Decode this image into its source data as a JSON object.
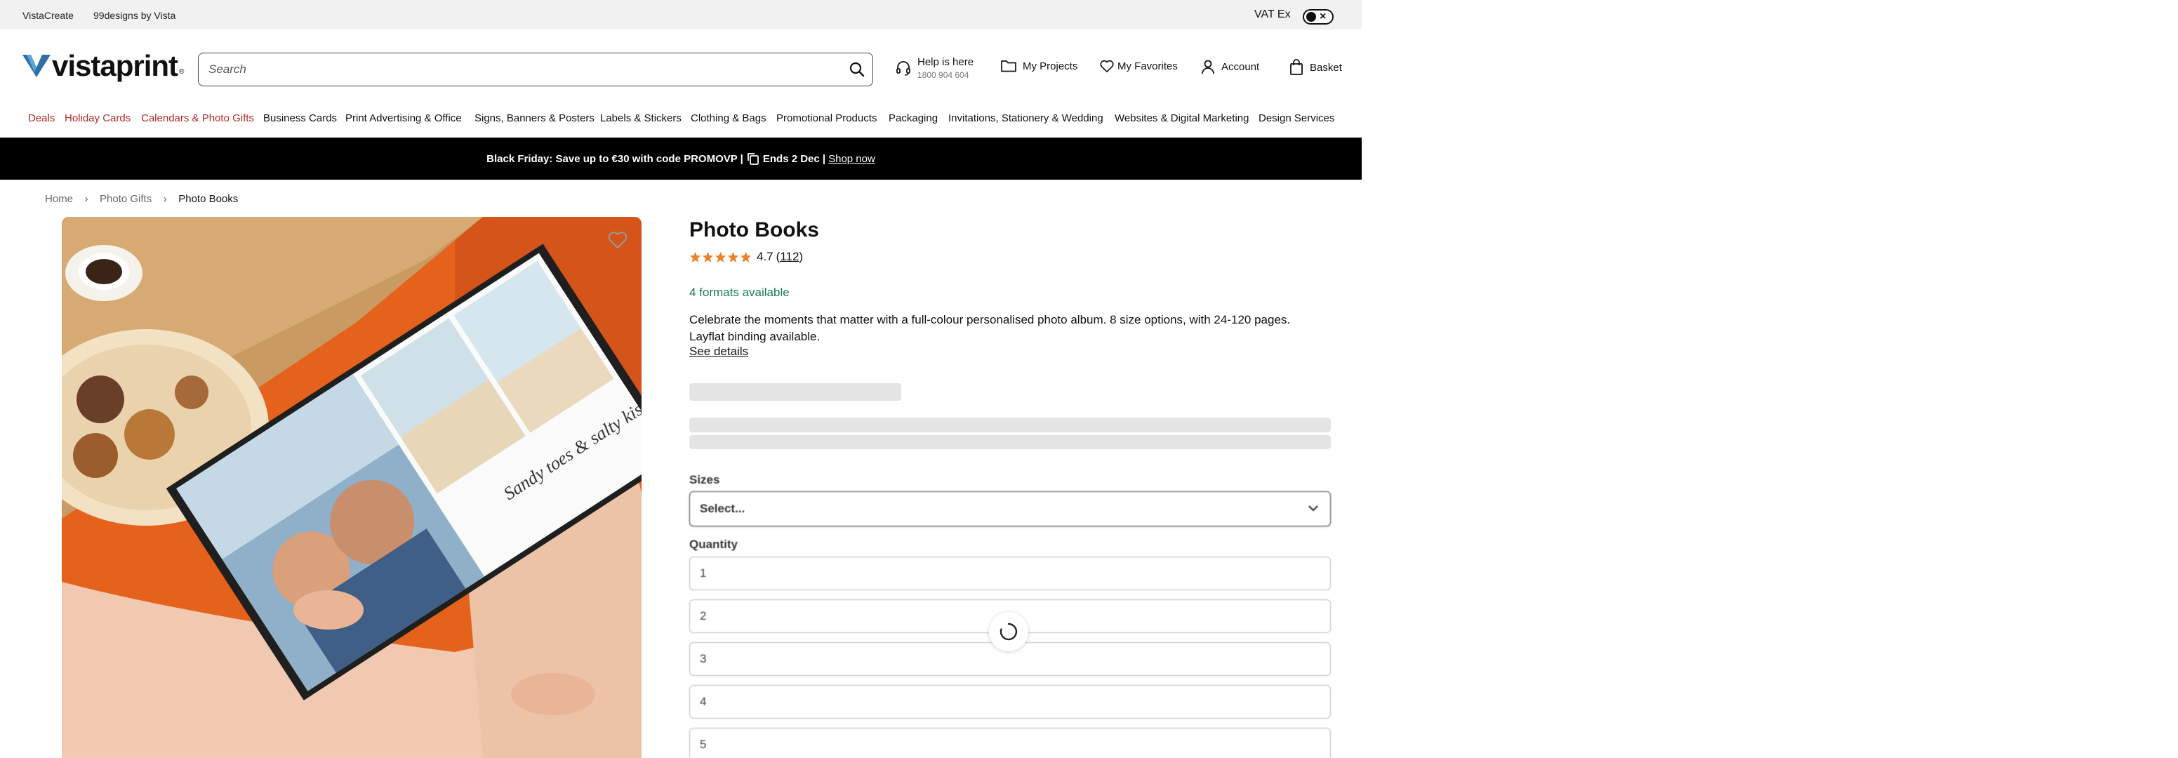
{
  "utility_bar": {
    "links": [
      "VistaCreate",
      "99designs by Vista"
    ],
    "vat_label": "VAT Ex",
    "vat_toggle_state": "off"
  },
  "header": {
    "logo_text": "vistaprint",
    "logo_tm": "®",
    "search_placeholder": "Search",
    "search_value": "",
    "help_title": "Help is here",
    "help_phone": "1800 904 604",
    "my_projects": "My Projects",
    "my_favorites": "My Favorites",
    "account": "Account",
    "basket": "Basket",
    "icons": [
      "search-icon",
      "headset-icon",
      "folder-icon",
      "heart-icon",
      "user-icon",
      "shopping-bag-icon"
    ]
  },
  "nav": {
    "items": [
      {
        "label": "Deals",
        "highlight": true
      },
      {
        "label": "Holiday Cards",
        "highlight": true
      },
      {
        "label": "Calendars & Photo Gifts",
        "highlight": true
      },
      {
        "label": "Business Cards",
        "highlight": false
      },
      {
        "label": "Print Advertising & Office",
        "highlight": false
      },
      {
        "label": "Signs, Banners & Posters",
        "highlight": false
      },
      {
        "label": "Labels & Stickers",
        "highlight": false
      },
      {
        "label": "Clothing & Bags",
        "highlight": false
      },
      {
        "label": "Promotional Products",
        "highlight": false
      },
      {
        "label": "Packaging",
        "highlight": false
      },
      {
        "label": "Invitations, Stationery & Wedding",
        "highlight": false
      },
      {
        "label": "Websites & Digital Marketing",
        "highlight": false
      },
      {
        "label": "Design Services",
        "highlight": false
      }
    ],
    "highlight_color": "#b22b27"
  },
  "promo": {
    "text_before": "Black Friday: Save up to €30 with code PROMOVP |",
    "text_after": "Ends 2 Dec |",
    "link": "Shop now"
  },
  "breadcrumb": {
    "items": [
      "Home",
      "Photo Gifts",
      "Photo Books"
    ]
  },
  "hero": {
    "image_caption_script": "Sandy toes & salty kisses"
  },
  "product": {
    "title": "Photo Books",
    "rating_value": "4.7",
    "rating_count": "(112)",
    "rating_link_text": "112",
    "stars": 4.7,
    "star_color": "#e8852c",
    "formats_text": "4 formats available",
    "formats_color": "#1b7a56",
    "description": "Celebrate the moments that matter with a full-colour personalised photo album. 8 size options, with 24-120 pages. Layflat binding available.",
    "see_details": "See details",
    "sizes_label": "Sizes",
    "sizes_selected": "Select...",
    "quantity_label": "Quantity",
    "quantity_options": [
      "1",
      "2",
      "3",
      "4",
      "5"
    ]
  }
}
